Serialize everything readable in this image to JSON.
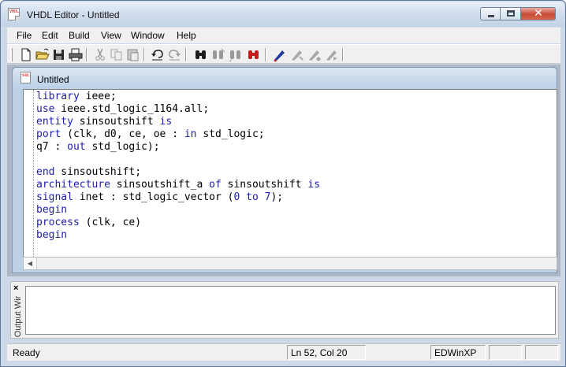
{
  "window": {
    "title": "VHDL Editor - Untitled",
    "icon": "vhdl-document-icon"
  },
  "title_buttons": {
    "minimize": "minimize-icon",
    "maximize": "maximize-icon",
    "close": "✕"
  },
  "menu": [
    "File",
    "Edit",
    "Build",
    "View",
    "Window",
    "Help"
  ],
  "toolbar": {
    "buttons": [
      "new-file",
      "open-folder",
      "save",
      "print",
      "cut",
      "copy",
      "paste",
      "undo",
      "redo",
      "find",
      "find-next",
      "find-prev",
      "replace",
      "build",
      "compile",
      "check",
      "run"
    ]
  },
  "document": {
    "title": "Untitled",
    "icon": "vhdl-document-icon"
  },
  "code": [
    [
      {
        "t": "library",
        "k": 1
      },
      {
        "t": " ieee;"
      }
    ],
    [
      {
        "t": "use",
        "k": 1
      },
      {
        "t": " ieee.std_logic_1164.all;"
      }
    ],
    [
      {
        "t": "entity",
        "k": 1
      },
      {
        "t": " sinsoutshift "
      },
      {
        "t": "is",
        "k": 1
      }
    ],
    [
      {
        "t": "port",
        "k": 1
      },
      {
        "t": " (clk, d0, ce, oe : "
      },
      {
        "t": "in",
        "k": 1
      },
      {
        "t": " std_logic;"
      }
    ],
    [
      {
        "t": "q7 : "
      },
      {
        "t": "out",
        "k": 1
      },
      {
        "t": " std_logic);"
      }
    ],
    [
      {
        "t": ""
      }
    ],
    [
      {
        "t": "end",
        "k": 1
      },
      {
        "t": " sinsoutshift;"
      }
    ],
    [
      {
        "t": "architecture",
        "k": 1
      },
      {
        "t": " sinsoutshift_a "
      },
      {
        "t": "of",
        "k": 1
      },
      {
        "t": " sinsoutshift "
      },
      {
        "t": "is",
        "k": 1
      }
    ],
    [
      {
        "t": "signal",
        "k": 1
      },
      {
        "t": " inet : std_logic_vector ("
      },
      {
        "t": "0",
        "k": 1
      },
      {
        "t": " "
      },
      {
        "t": "to",
        "k": 1
      },
      {
        "t": " "
      },
      {
        "t": "7",
        "k": 1
      },
      {
        "t": ");"
      }
    ],
    [
      {
        "t": "begin",
        "k": 1
      }
    ],
    [
      {
        "t": "process",
        "k": 1
      },
      {
        "t": " (clk, ce)"
      }
    ],
    [
      {
        "t": "begin",
        "k": 1
      }
    ]
  ],
  "output": {
    "close": "×",
    "label": "Output Wir"
  },
  "status": {
    "ready": "Ready",
    "position": "Ln 52, Col 20",
    "app": "EDWinXP"
  }
}
